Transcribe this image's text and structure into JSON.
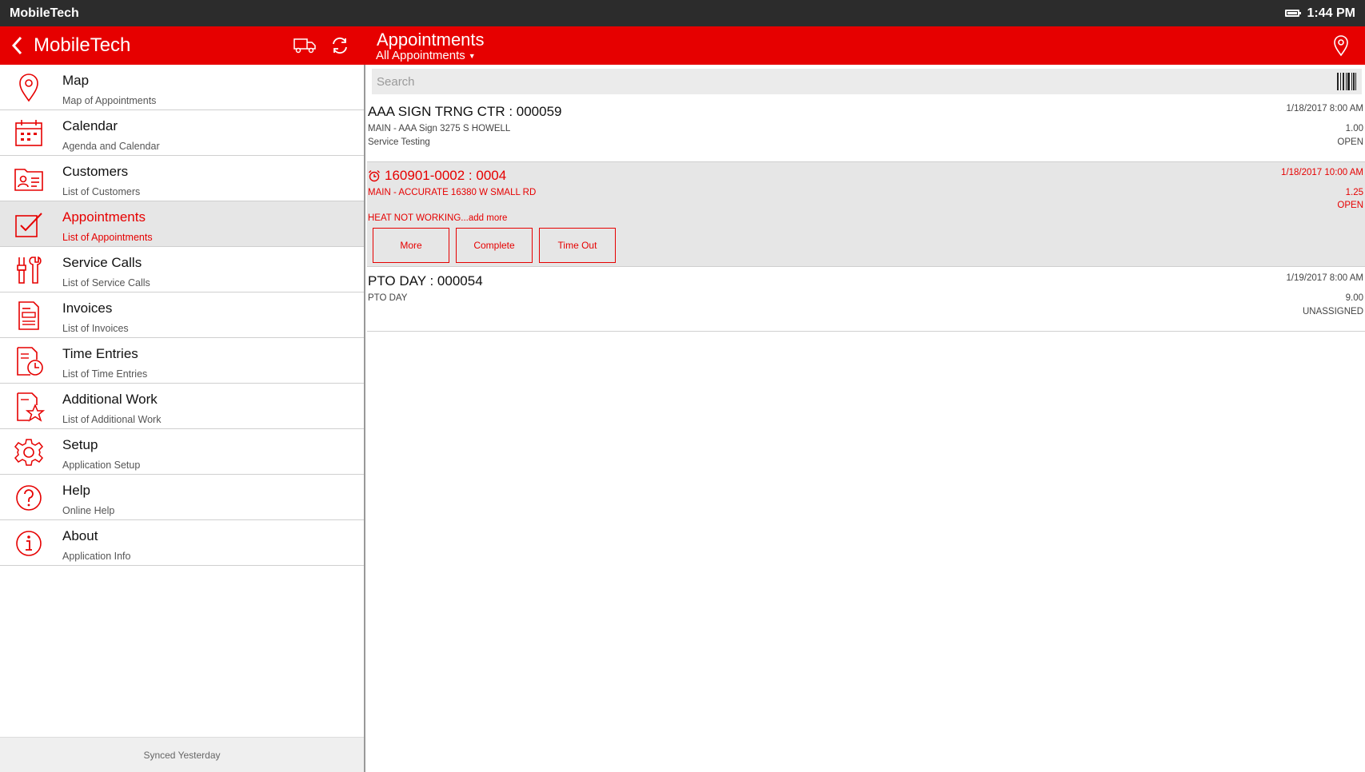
{
  "statusbar": {
    "app_name": "MobileTech",
    "time": "1:44 PM"
  },
  "header": {
    "app_title": "MobileTech",
    "page_title": "Appointments",
    "filter": "All Appointments"
  },
  "sidebar": {
    "items": [
      {
        "label": "Map",
        "sub": "Map of Appointments",
        "icon": "map-pin-icon"
      },
      {
        "label": "Calendar",
        "sub": "Agenda and Calendar",
        "icon": "calendar-icon"
      },
      {
        "label": "Customers",
        "sub": "List of Customers",
        "icon": "customer-card-icon"
      },
      {
        "label": "Appointments",
        "sub": "List of Appointments",
        "icon": "checklist-icon"
      },
      {
        "label": "Service Calls",
        "sub": "List of Service Calls",
        "icon": "tools-icon"
      },
      {
        "label": "Invoices",
        "sub": "List of Invoices",
        "icon": "invoice-icon"
      },
      {
        "label": "Time Entries",
        "sub": "List of Time Entries",
        "icon": "time-entry-icon"
      },
      {
        "label": "Additional Work",
        "sub": "List of Additional Work",
        "icon": "star-document-icon"
      },
      {
        "label": "Setup",
        "sub": "Application Setup",
        "icon": "gear-icon"
      },
      {
        "label": "Help",
        "sub": "Online Help",
        "icon": "help-icon"
      },
      {
        "label": "About",
        "sub": "Application Info",
        "icon": "info-icon"
      }
    ],
    "sync_status": "Synced Yesterday"
  },
  "search": {
    "placeholder": "Search"
  },
  "appointments": [
    {
      "title": "AAA SIGN TRNG CTR : 000059",
      "location": "MAIN - AAA Sign 3275 S HOWELL",
      "description": "Service Testing",
      "date": "1/18/2017 8:00 AM",
      "hours": "1.00",
      "status": "OPEN"
    },
    {
      "title": "160901-0002 : 0004",
      "location": "MAIN - ACCURATE 16380 W SMALL RD",
      "description": "HEAT NOT WORKING...add more",
      "date": "1/18/2017 10:00 AM",
      "hours": "1.25",
      "status": "OPEN",
      "actions": {
        "more": "More",
        "complete": "Complete",
        "time_out": "Time Out"
      }
    },
    {
      "title": "PTO DAY : 000054",
      "location": "PTO DAY",
      "date": "1/19/2017 8:00 AM",
      "hours": "9.00",
      "status": "UNASSIGNED"
    }
  ],
  "colors": {
    "accent": "#e60000",
    "statusbar": "#2c2c2c",
    "selected": "#e6e6e6"
  },
  "battery_level": 0.9
}
